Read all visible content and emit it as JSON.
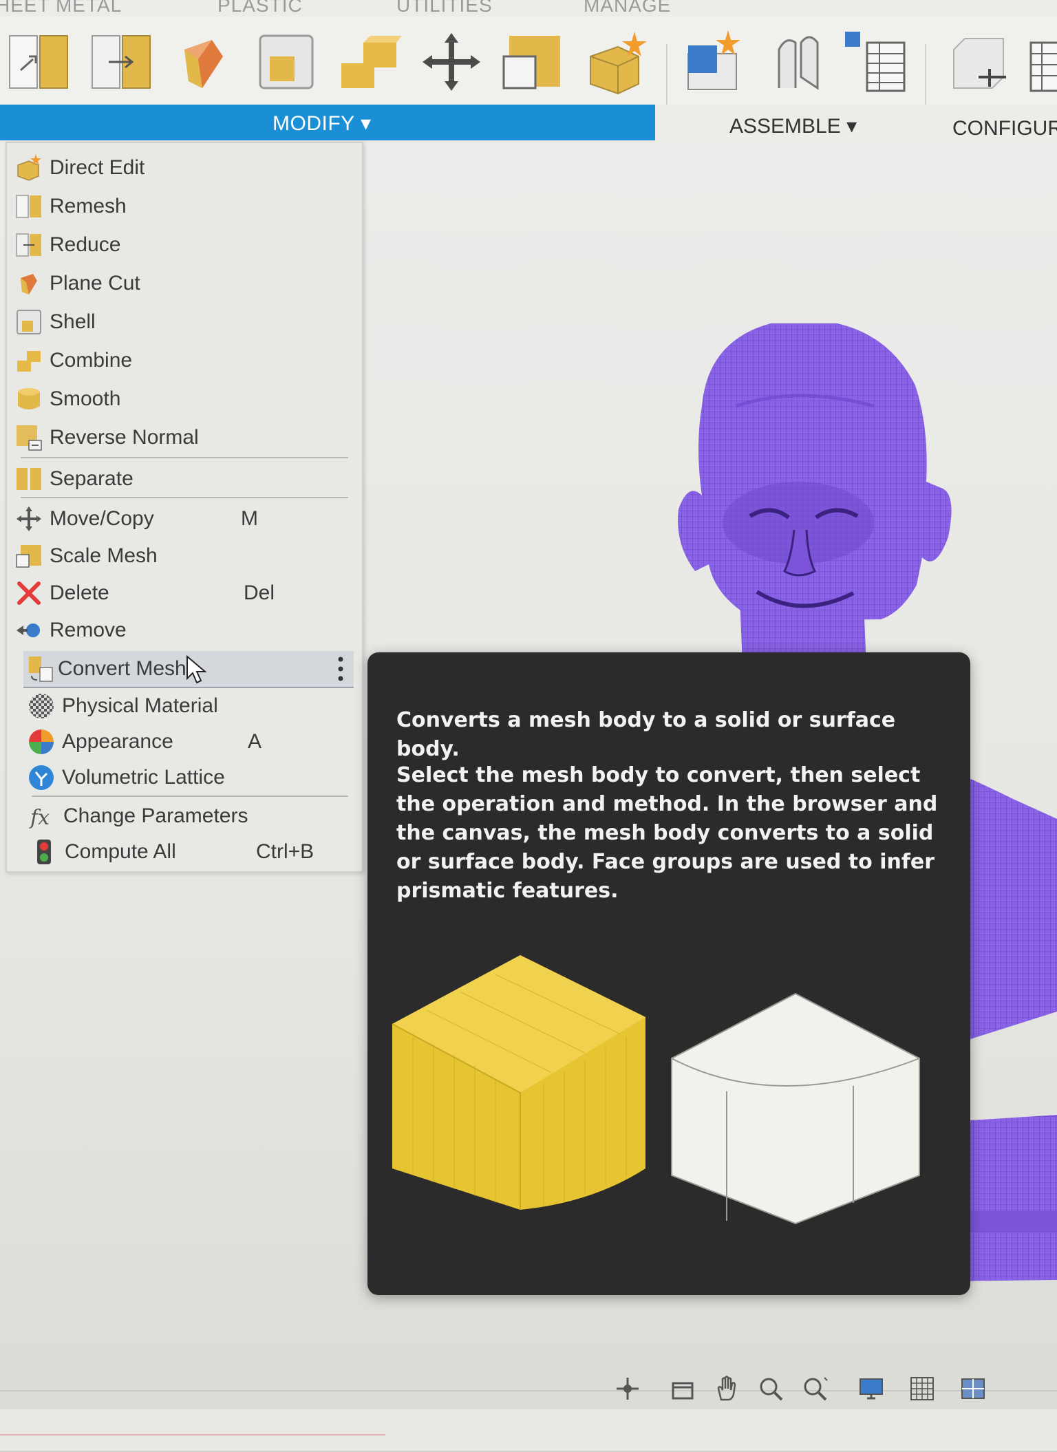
{
  "ribbon": {
    "tabs": [
      "HEET METAL",
      "PLASTIC",
      "UTILITIES",
      "MANAGE"
    ],
    "groups": {
      "modify": "MODIFY ▾",
      "assemble": "ASSEMBLE ▾",
      "configure": "CONFIGUR"
    },
    "accent_color": "#1b8fd6"
  },
  "modify_menu": {
    "items": [
      {
        "label": "Direct Edit",
        "shortcut": "",
        "icon": "direct-edit-icon"
      },
      {
        "label": "Remesh",
        "shortcut": "",
        "icon": "remesh-icon"
      },
      {
        "label": "Reduce",
        "shortcut": "",
        "icon": "reduce-icon"
      },
      {
        "label": "Plane Cut",
        "shortcut": "",
        "icon": "plane-cut-icon"
      },
      {
        "label": "Shell",
        "shortcut": "",
        "icon": "shell-icon"
      },
      {
        "label": "Combine",
        "shortcut": "",
        "icon": "combine-icon"
      },
      {
        "label": "Smooth",
        "shortcut": "",
        "icon": "smooth-icon"
      },
      {
        "label": "Reverse Normal",
        "shortcut": "",
        "icon": "reverse-normal-icon"
      },
      {
        "label": "Separate",
        "shortcut": "",
        "icon": "separate-icon"
      },
      {
        "label": "Move/Copy",
        "shortcut": "M",
        "icon": "move-copy-icon"
      },
      {
        "label": "Scale Mesh",
        "shortcut": "",
        "icon": "scale-mesh-icon"
      },
      {
        "label": "Delete",
        "shortcut": "Del",
        "icon": "delete-icon"
      },
      {
        "label": "Remove",
        "shortcut": "",
        "icon": "remove-icon"
      },
      {
        "label": "Convert Mesh",
        "shortcut": "",
        "icon": "convert-mesh-icon",
        "hovered": true
      },
      {
        "label": "Physical Material",
        "shortcut": "",
        "icon": "physical-material-icon"
      },
      {
        "label": "Appearance",
        "shortcut": "A",
        "icon": "appearance-icon"
      },
      {
        "label": "Volumetric Lattice",
        "shortcut": "",
        "icon": "volumetric-lattice-icon"
      },
      {
        "label": "Change Parameters",
        "shortcut": "",
        "icon": "fx-icon"
      },
      {
        "label": "Compute All",
        "shortcut": "Ctrl+B",
        "icon": "compute-all-icon"
      }
    ]
  },
  "tooltip": {
    "summary": "Converts a mesh body to a solid or surface body.",
    "detail": "Select the mesh body to convert, then select the operation and method. In the browser and the canvas, the mesh body converts to a solid or surface body. Face groups are used to infer prismatic features.",
    "background": "#2b2b2b"
  },
  "model": {
    "mesh_color": "#8a63e6"
  },
  "navbar": {
    "icons": [
      "orbit-icon",
      "look-at-icon",
      "pan-icon",
      "zoom-icon",
      "zoom-window-icon",
      "display-settings-icon",
      "grid-icon",
      "viewports-icon"
    ]
  }
}
